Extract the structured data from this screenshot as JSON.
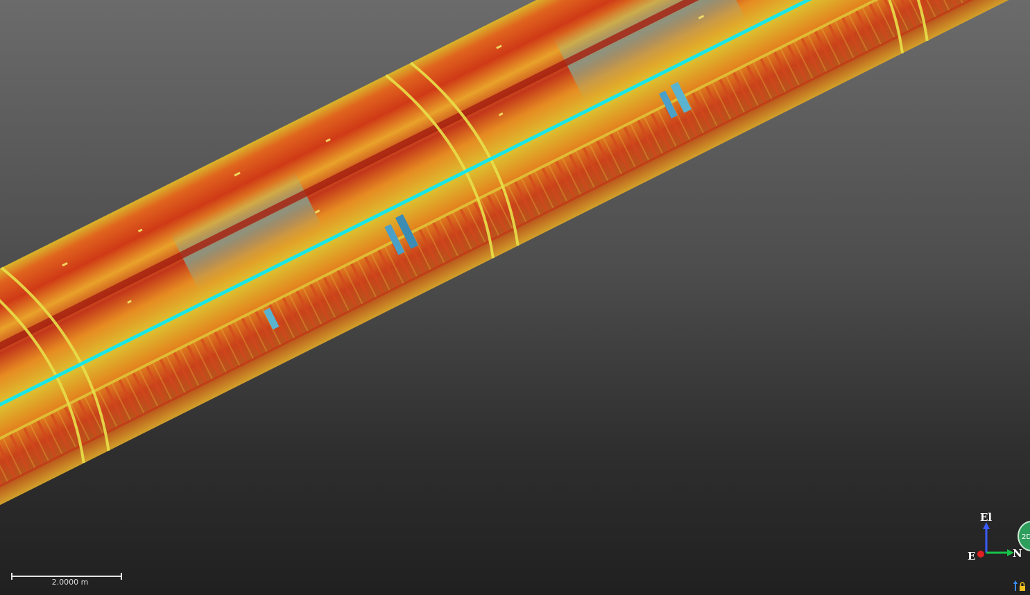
{
  "scale_bar": {
    "label": "2.0000 m"
  },
  "orientation_gizmo": {
    "up_label": "El",
    "east_label": "E",
    "north_label": "N",
    "up_color": "#3a5cff",
    "north_color": "#19c24a",
    "east_color": "#e02020"
  },
  "nav_badge": {
    "label": "2D",
    "color": "#2e9e5c"
  },
  "icons": {
    "bottom_right": "orientation-lock-icon"
  },
  "colors": {
    "background_top": "#6b6b6b",
    "background_bottom": "#202020",
    "tunnel_red": "#c8321a",
    "tunnel_orange": "#e07a1e",
    "tunnel_yellow": "#d8c82a",
    "tunnel_cyan": "#5fc8b8",
    "centerline": "#19e6e6"
  }
}
